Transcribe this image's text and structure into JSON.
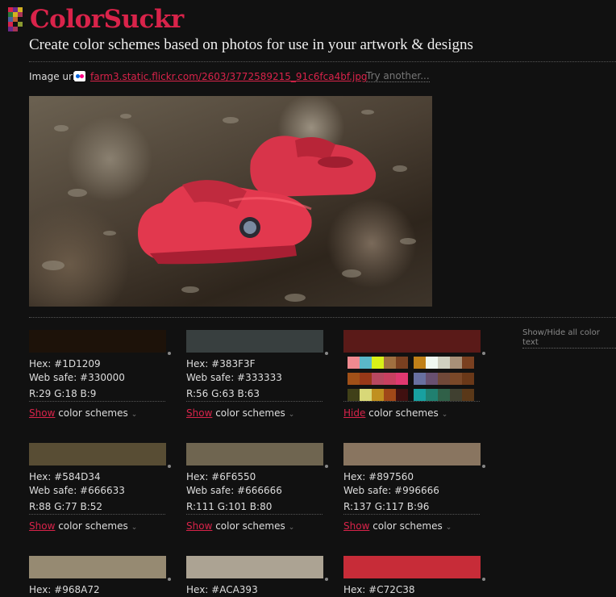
{
  "header": {
    "logo_text": "ColorSuckr",
    "tagline": "Create color schemes based on photos for use in your artwork & designs",
    "logo_colors": [
      "#d9234a",
      "#6a2a8a",
      "#2a7a3a",
      "#d4b020",
      "#aa3355",
      "#4a60a0",
      "#c06030",
      "#8a9a30"
    ]
  },
  "image_url_row": {
    "label": "Image url:",
    "link_text": "farm3.static.flickr.com/2603/3772589215_91c6fca4bf.jpg",
    "try_another": "Try another..."
  },
  "photo": {
    "alt_description_icon": "photo-icon"
  },
  "toggle_all_text": "Show/Hide all color text",
  "swatches": [
    {
      "color": "#1D1209",
      "hex": "Hex: #1D1209",
      "websafe": "Web safe: #330000",
      "rgb": "R:29 G:18 B:9",
      "action": "Show",
      "rest": " color schemes"
    },
    {
      "color": "#383F3F",
      "hex": "Hex: #383F3F",
      "websafe": "Web safe: #333333",
      "rgb": "R:56 G:63 B:63",
      "action": "Show",
      "rest": " color schemes"
    },
    {
      "color": "#5A1A18",
      "action": "Hide",
      "rest": " color schemes"
    },
    {
      "color": "#584D34",
      "hex": "Hex: #584D34",
      "websafe": "Web safe: #666633",
      "rgb": "R:88 G:77 B:52",
      "action": "Show",
      "rest": " color schemes"
    },
    {
      "color": "#6F6550",
      "hex": "Hex: #6F6550",
      "websafe": "Web safe: #666666",
      "rgb": "R:111 G:101 B:80",
      "action": "Show",
      "rest": " color schemes"
    },
    {
      "color": "#897560",
      "hex": "Hex: #897560",
      "websafe": "Web safe: #996666",
      "rgb": "R:137 G:117 B:96",
      "action": "Show",
      "rest": " color schemes"
    },
    {
      "color": "#968A72",
      "hex": "Hex: #968A72"
    },
    {
      "color": "#ACA393",
      "hex": "Hex: #ACA393"
    },
    {
      "color": "#C72C38",
      "hex": "Hex: #C72C38"
    }
  ],
  "scheme_palettes": [
    [
      "#f08a90",
      "#5ab8c8",
      "#d8f018",
      "#a07040",
      "#7a4020"
    ],
    [
      "#c08018",
      "#f0f8f0",
      "#d0d0c0",
      "#a89078",
      "#7a4020"
    ],
    [
      "#a05018",
      "#983818",
      "#b84860",
      "#c84060",
      "#e03870"
    ],
    [
      "#6870a0",
      "#685070",
      "#704838",
      "#7a4828",
      "#6a3818"
    ],
    [
      "#404018",
      "#d8d878",
      "#c09020",
      "#a04818",
      "#401010"
    ],
    [
      "#18a0a0",
      "#208070",
      "#306048",
      "#404030",
      "#5a3818"
    ]
  ]
}
